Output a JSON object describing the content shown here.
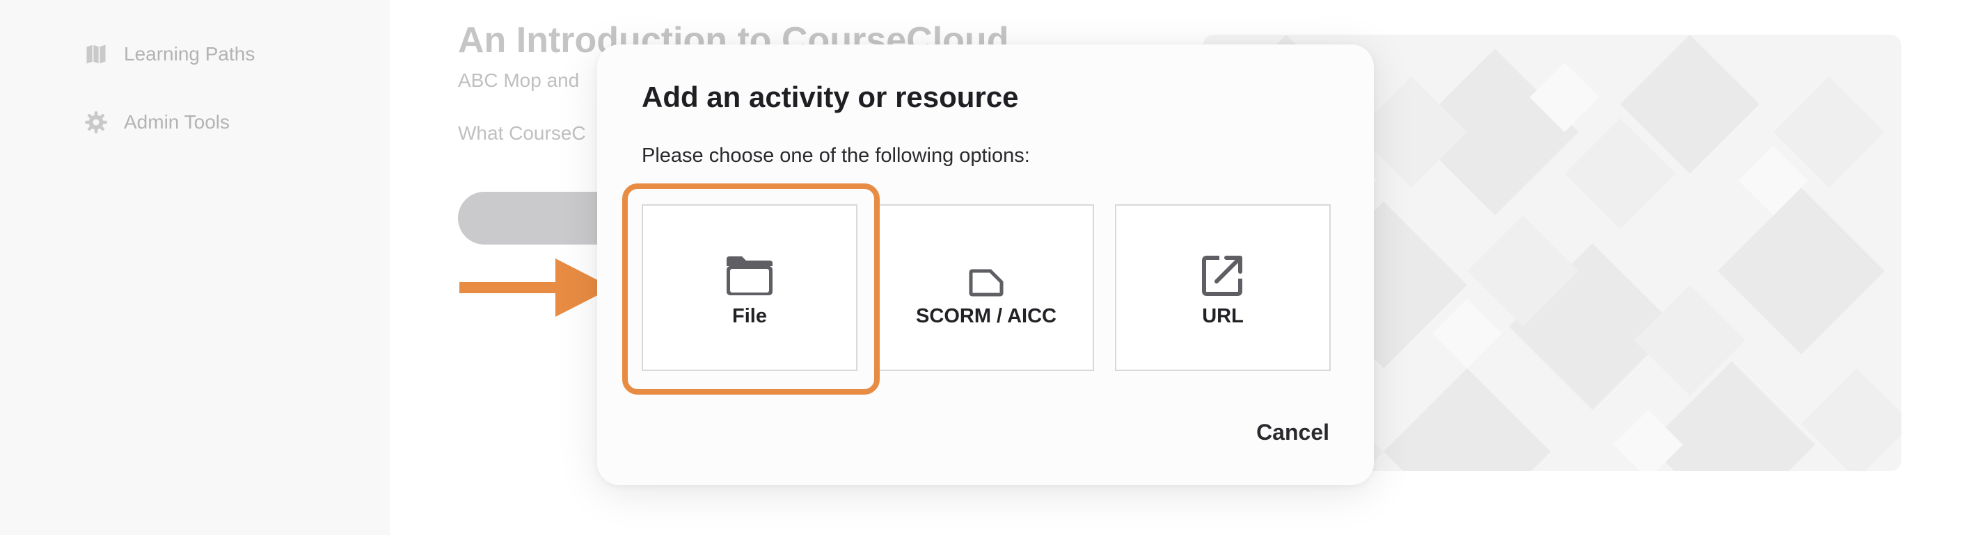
{
  "sidebar": {
    "items": [
      {
        "label": "Learning Paths",
        "icon": "map-icon"
      },
      {
        "label": "Admin Tools",
        "icon": "gear-icon"
      }
    ]
  },
  "course": {
    "title": "An Introduction to CourseCloud",
    "subtitle": "ABC Mop and",
    "description": "What CourseC"
  },
  "modal": {
    "title": "Add an activity or resource",
    "prompt": "Please choose one of the following options:",
    "options": [
      {
        "label": "File",
        "icon": "folder-icon"
      },
      {
        "label": "SCORM / AICC",
        "icon": "scorm-package-icon"
      },
      {
        "label": "URL",
        "icon": "external-link-icon"
      }
    ],
    "cancel_label": "Cancel"
  },
  "colors": {
    "annotation": "#e88c43",
    "sidebar_bg": "#f7f7f7",
    "icon": "#5f5f63"
  }
}
